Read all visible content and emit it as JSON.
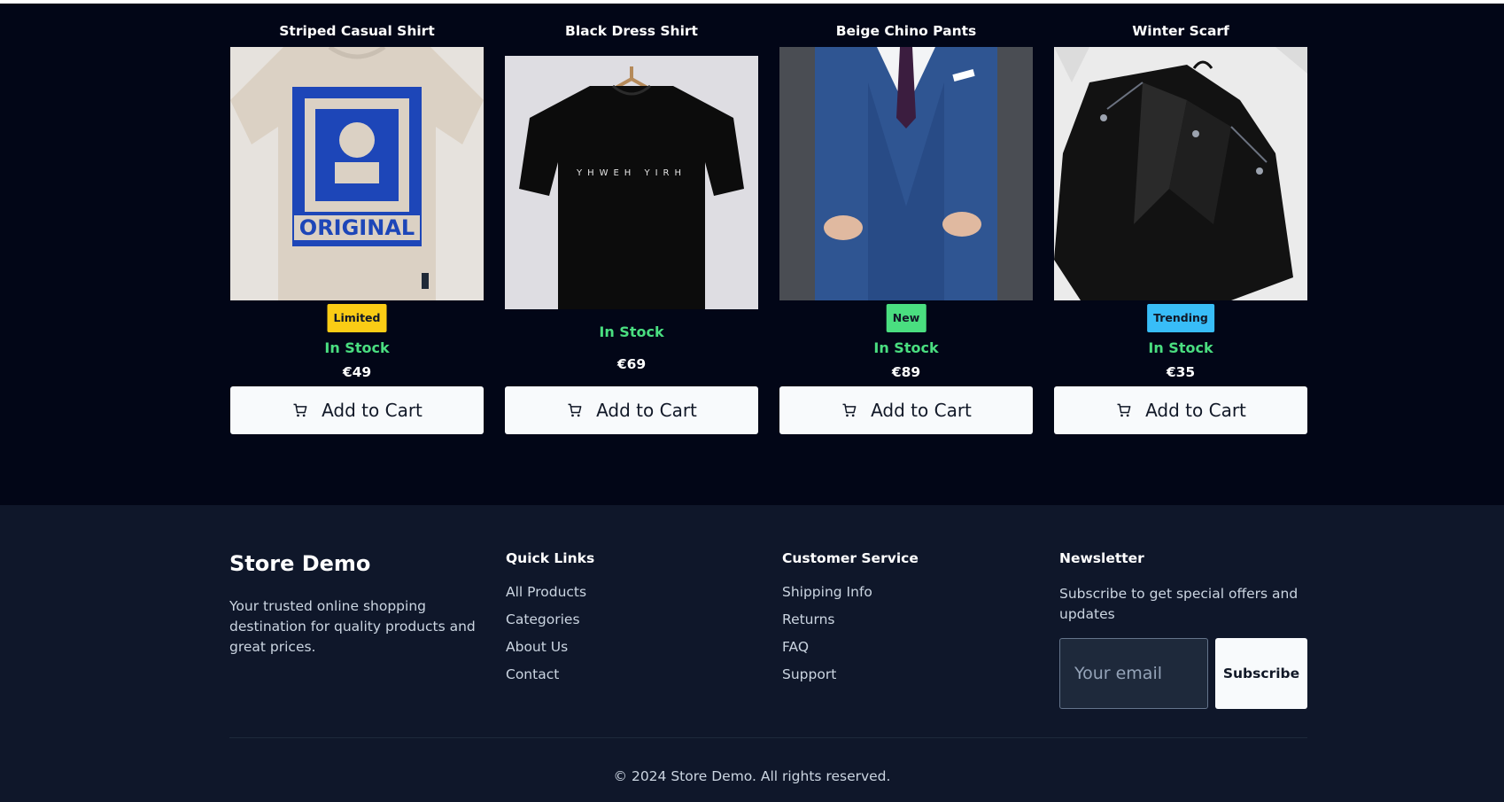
{
  "products": [
    {
      "title": "Striped Casual Shirt",
      "badge": "Limited",
      "badge_color": "#facc15",
      "stock": "In Stock",
      "price": "€49",
      "button": "Add to Cart",
      "image": "beige-tshirt-blue-print"
    },
    {
      "title": "Black Dress Shirt",
      "badge": "",
      "badge_color": "",
      "stock": "In Stock",
      "price": "€69",
      "button": "Add to Cart",
      "image": "black-tshirt-on-hanger"
    },
    {
      "title": "Beige Chino Pants",
      "badge": "New",
      "badge_color": "#4ade80",
      "stock": "In Stock",
      "price": "€89",
      "button": "Add to Cart",
      "image": "blue-plaid-suit"
    },
    {
      "title": "Winter Scarf",
      "badge": "Trending",
      "badge_color": "#38bdf8",
      "stock": "In Stock",
      "price": "€35",
      "button": "Add to Cart",
      "image": "black-leather-jacket"
    }
  ],
  "footer": {
    "brand": "Store Demo",
    "tagline": "Your trusted online shopping destination for quality products and great prices.",
    "quick_links": {
      "title": "Quick Links",
      "items": [
        "All Products",
        "Categories",
        "About Us",
        "Contact"
      ]
    },
    "customer_service": {
      "title": "Customer Service",
      "items": [
        "Shipping Info",
        "Returns",
        "FAQ",
        "Support"
      ]
    },
    "newsletter": {
      "title": "Newsletter",
      "text": "Subscribe to get special offers and updates",
      "placeholder": "Your email",
      "button": "Subscribe"
    },
    "copyright": "© 2024 Store Demo. All rights reserved."
  },
  "colors": {
    "stock": "#4ade80",
    "page_bg": "#020617",
    "footer_bg": "#0f172a",
    "button_bg": "#f8fafc"
  }
}
